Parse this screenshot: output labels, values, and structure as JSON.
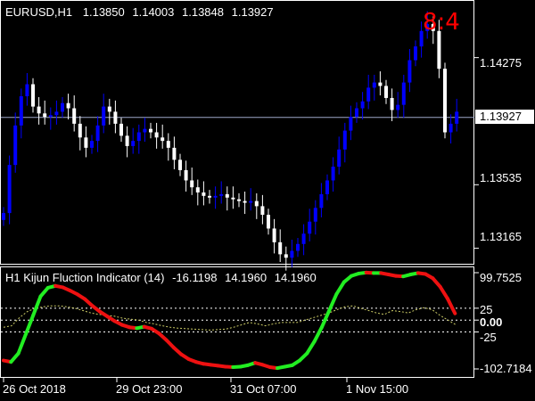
{
  "symbol": {
    "name": "EURUSD,H1",
    "prices": [
      "1.13850",
      "1.14003",
      "1.13848",
      "1.13927"
    ]
  },
  "timer": "8:4",
  "price_axis": {
    "labels": [
      "1.14275",
      "1.13535",
      "1.13165"
    ],
    "current_price": "1.13927"
  },
  "indicator": {
    "title": "H1 Kijun Fluction Indicator (14)",
    "values": [
      "-16.1198",
      "14.1960",
      "14.1960"
    ],
    "axis_labels": [
      "99.7525",
      "25",
      "0.00",
      "-25",
      "-102.7184"
    ]
  },
  "time_axis": {
    "labels": [
      "26 Oct 2018",
      "29 Oct 23:00",
      "31 Oct 07:00",
      "1 Nov 15:00"
    ]
  },
  "colors": {
    "bull_candle": "#0000ff",
    "bear_candle": "#ffffff",
    "up_line": "#22ee22",
    "down_line": "#ee1111",
    "dotted_line": "#cccc66",
    "timer": "#ff0000"
  },
  "chart_data": [
    {
      "type": "candlestick",
      "title": "EURUSD,H1",
      "ylim": [
        1.1308,
        1.146
      ],
      "y_ticks": [
        1.13165,
        1.13535,
        1.14275
      ],
      "current_price": 1.13927,
      "closes": [
        1.1337,
        1.1365,
        1.1388,
        1.1405,
        1.1412,
        1.1399,
        1.1395,
        1.1393,
        1.1394,
        1.1396,
        1.1401,
        1.1398,
        1.1389,
        1.1381,
        1.1375,
        1.1379,
        1.1388,
        1.1399,
        1.1396,
        1.1389,
        1.1382,
        1.1376,
        1.1379,
        1.1384,
        1.1386,
        1.1384,
        1.1381,
        1.1379,
        1.1375,
        1.1368,
        1.1362,
        1.1356,
        1.1352,
        1.1349,
        1.1347,
        1.1346,
        1.1347,
        1.1348,
        1.1346,
        1.1345,
        1.1344,
        1.1343,
        1.1344,
        1.1341,
        1.1336,
        1.1328,
        1.132,
        1.1313,
        1.1311,
        1.1315,
        1.1319,
        1.1325,
        1.1332,
        1.134,
        1.1348,
        1.1356,
        1.1364,
        1.1374,
        1.1385,
        1.1393,
        1.1398,
        1.1402,
        1.141,
        1.1413,
        1.1411,
        1.1404,
        1.1397,
        1.14,
        1.1413,
        1.1426,
        1.1434,
        1.1443,
        1.1447,
        1.1443,
        1.1421,
        1.1384,
        1.1389,
        1.1396
      ]
    },
    {
      "type": "line",
      "title": "H1 Kijun Fluction Indicator (14)",
      "ylim": [
        -102.7184,
        99.7525
      ],
      "y_ticks": [
        99.7525,
        25,
        0,
        -25,
        -102.7184
      ],
      "reference_lines": [
        25,
        0,
        -25
      ],
      "series": [
        {
          "values": [
            -85,
            -88,
            -70,
            -30,
            10,
            50,
            68,
            72,
            69,
            62,
            54,
            44,
            30,
            18,
            8,
            -2,
            -10,
            -15,
            -17,
            -14,
            -18,
            -28,
            -42,
            -58,
            -72,
            -82,
            -88,
            -92,
            -94,
            -96,
            -98,
            -99,
            -98,
            -95,
            -90,
            -94,
            -99,
            -101,
            -98,
            -95,
            -85,
            -70,
            -45,
            -15,
            20,
            55,
            80,
            93,
            98,
            100,
            99,
            99,
            96,
            93,
            92,
            96,
            99,
            97,
            88,
            70,
            45,
            14
          ]
        },
        {
          "values": [
            -15,
            -12,
            5,
            18,
            25,
            28,
            30,
            30,
            28,
            25,
            20,
            15,
            12,
            10,
            8,
            4,
            2,
            0,
            -5,
            -8,
            -12,
            -15,
            -17,
            -18,
            -19,
            -20,
            -21,
            -20,
            -19,
            -15,
            -10,
            -5,
            -8,
            -12,
            -8,
            -5,
            -5,
            -5,
            0,
            5,
            10,
            15,
            22,
            28,
            30,
            25,
            20,
            15,
            12,
            20,
            18,
            15,
            22,
            26,
            22,
            10,
            0,
            -10
          ]
        }
      ]
    }
  ]
}
